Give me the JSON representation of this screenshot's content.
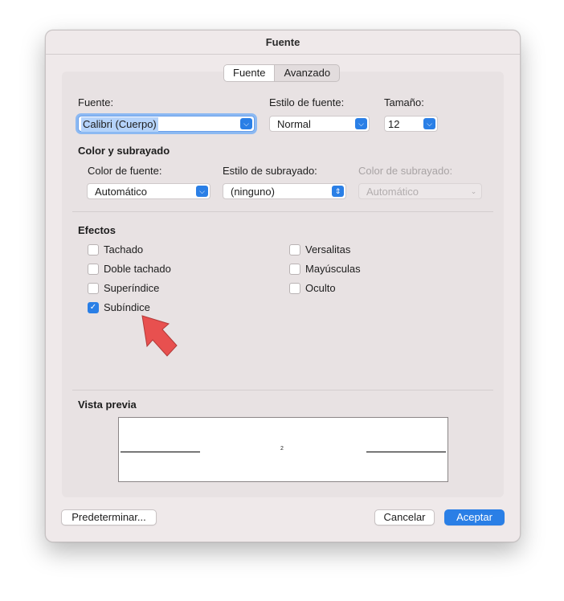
{
  "window": {
    "title": "Fuente"
  },
  "tabs": [
    {
      "label": "Fuente"
    },
    {
      "label": "Avanzado"
    }
  ],
  "font": {
    "font_label": "Fuente:",
    "font_value": "Calibri (Cuerpo)",
    "style_label": "Estilo de fuente:",
    "style_value": "Normal",
    "size_label": "Tamaño:",
    "size_value": "12"
  },
  "color_section": {
    "heading": "Color y subrayado",
    "font_color_label": "Color de fuente:",
    "font_color_value": "Automático",
    "underline_style_label": "Estilo de subrayado:",
    "underline_style_value": "(ninguno)",
    "underline_color_label": "Color de subrayado:",
    "underline_color_value": "Automático"
  },
  "effects": {
    "heading": "Efectos",
    "left": [
      {
        "label": "Tachado",
        "checked": false
      },
      {
        "label": "Doble tachado",
        "checked": false
      },
      {
        "label": "Superíndice",
        "checked": false
      },
      {
        "label": "Subíndice",
        "checked": true
      }
    ],
    "right": [
      {
        "label": "Versalitas",
        "checked": false
      },
      {
        "label": "Mayúsculas",
        "checked": false
      },
      {
        "label": "Oculto",
        "checked": false
      }
    ]
  },
  "preview": {
    "heading": "Vista previa",
    "sample_text": "2"
  },
  "buttons": {
    "default": "Predeterminar...",
    "cancel": "Cancelar",
    "ok": "Aceptar"
  },
  "colors": {
    "accent": "#2a7fe6",
    "annotation_arrow": "#e8504f"
  }
}
